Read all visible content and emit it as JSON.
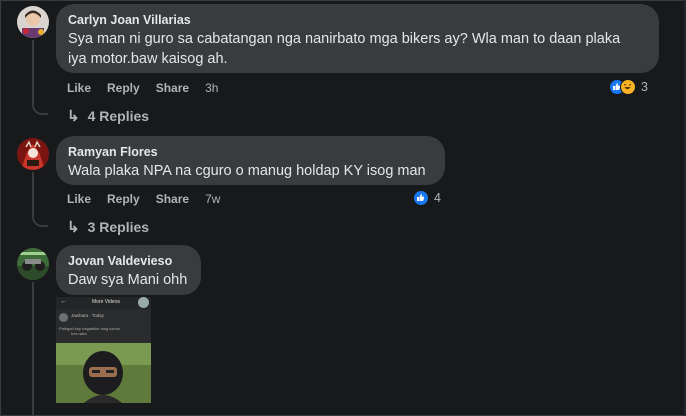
{
  "comments": [
    {
      "author": "Carlyn Joan Villarias",
      "text_line1": "Sya man ni guro sa cabatangan nga nanirbato mga bikers ay? Wla man to daan plaka",
      "text_line2": "iya motor.baw kaisog ah.",
      "actions": {
        "like": "Like",
        "reply": "Reply",
        "share": "Share",
        "time": "3h"
      },
      "reaction_count": "3",
      "reaction_icons": [
        "like-icon",
        "haha-icon"
      ],
      "replies_label": "4 Replies"
    },
    {
      "author": "Ramyan Flores",
      "text_line1": "Wala plaka NPA na cguro o manug holdap KY isog man",
      "actions": {
        "like": "Like",
        "reply": "Reply",
        "share": "Share",
        "time": "7w"
      },
      "reaction_count": "4",
      "reaction_icons": [
        "like-icon"
      ],
      "replies_label": "3 Replies"
    },
    {
      "author": "Jovan Valdevieso",
      "text_line1": "Daw sya Mani ohh",
      "attachment": {
        "header": "More Videos",
        "post_author": "Jawhara · Today",
        "post_text": "Pahigad kay nagtabike lang kamui",
        "post_text2": "bes raba"
      }
    }
  ],
  "colors": {
    "background": "#18191a",
    "bubble": "#3a3b3c",
    "text": "#e4e6eb",
    "secondary": "#b0b3b8",
    "like_blue": "#1877f2",
    "haha_yellow": "#f7b125"
  }
}
